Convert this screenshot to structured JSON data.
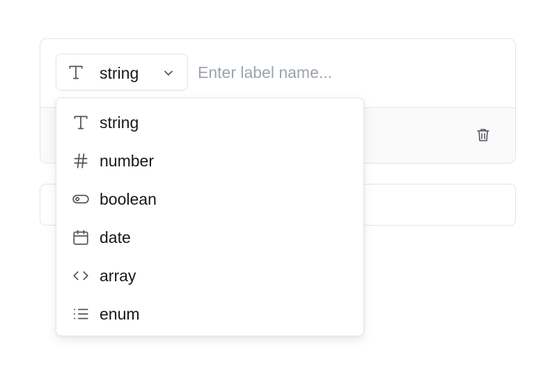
{
  "field": {
    "selected_type": "string",
    "label_placeholder": "Enter label name...",
    "label_value": ""
  },
  "dropdown": {
    "options": [
      {
        "label": "string",
        "icon": "text-type-icon"
      },
      {
        "label": "number",
        "icon": "hash-icon"
      },
      {
        "label": "boolean",
        "icon": "toggle-icon"
      },
      {
        "label": "date",
        "icon": "calendar-icon"
      },
      {
        "label": "array",
        "icon": "code-brackets-icon"
      },
      {
        "label": "enum",
        "icon": "list-icon"
      }
    ]
  },
  "colors": {
    "border": "#e4e4e7",
    "icon": "#52525b",
    "text": "#18181b",
    "placeholder": "#9ca3af"
  }
}
